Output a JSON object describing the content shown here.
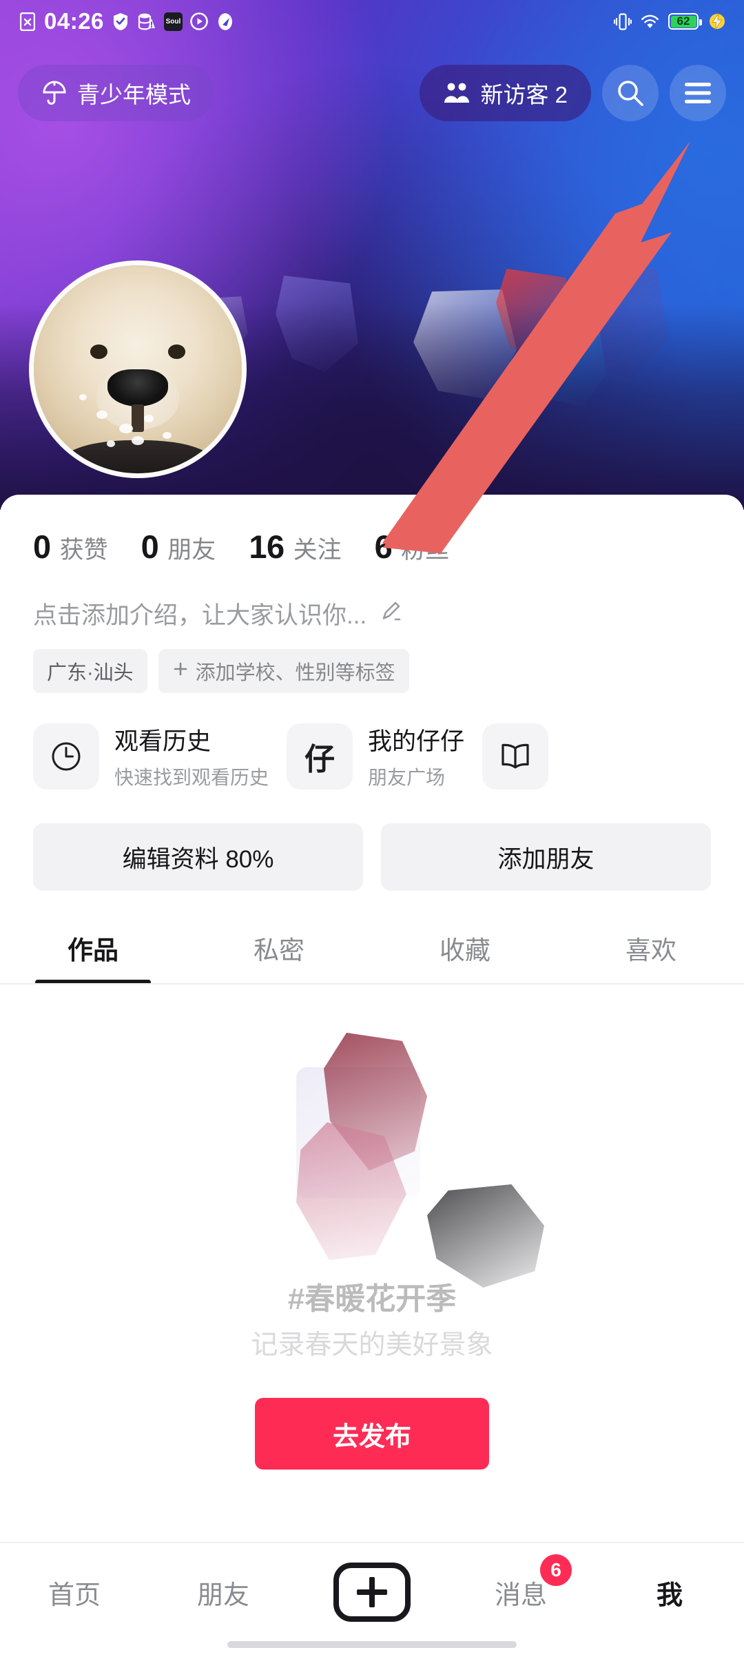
{
  "status_bar": {
    "time": "04:26",
    "battery_level": "62",
    "left_icons": [
      "sim-error-icon",
      "shield-check-icon",
      "data-saver-icon",
      "soul-app-icon",
      "play-circle-icon",
      "compass-icon"
    ],
    "right_icons": [
      "vibrate-icon",
      "wifi-icon",
      "battery-icon",
      "charging-bolt-icon"
    ]
  },
  "top_bar": {
    "teen_mode_label": "青少年模式",
    "teen_mode_icon": "umbrella-icon",
    "visitor_label": "新访客 2",
    "visitor_icon": "visitors-icon",
    "search_icon": "search-icon",
    "menu_icon": "hamburger-menu-icon"
  },
  "annotation": {
    "type": "arrow",
    "color": "#e8635f",
    "points_to": "hamburger-menu-icon"
  },
  "profile": {
    "avatar_alt": "golden-retriever-puppy-avatar",
    "stats": [
      {
        "value": "0",
        "label": "获赞"
      },
      {
        "value": "0",
        "label": "朋友"
      },
      {
        "value": "16",
        "label": "关注"
      },
      {
        "value": "6",
        "label": "粉丝"
      }
    ],
    "bio_placeholder": "点击添加介绍，让大家认识你...",
    "bio_edit_icon": "pencil-icon",
    "tags": [
      {
        "label": "广东·汕头",
        "icon": null
      },
      {
        "label": "添加学校、性别等标签",
        "icon": "plus-icon"
      }
    ]
  },
  "quick_cards": [
    {
      "icon": "clock-icon",
      "title": "观看历史",
      "subtitle": "快速找到观看历史"
    },
    {
      "icon": "zai-character-icon",
      "icon_text": "仔",
      "title": "我的仔仔",
      "subtitle": "朋友广场"
    },
    {
      "icon": "book-icon",
      "title": "",
      "subtitle": ""
    }
  ],
  "actions": [
    {
      "label": "编辑资料 80%"
    },
    {
      "label": "添加朋友"
    }
  ],
  "content_tabs": [
    {
      "label": "作品",
      "active": true
    },
    {
      "label": "私密",
      "active": false
    },
    {
      "label": "收藏",
      "active": false
    },
    {
      "label": "喜欢",
      "active": false
    }
  ],
  "empty_state": {
    "headline": "#春暖花开季",
    "subline": "记录春天的美好景象",
    "publish_label": "去发布",
    "publish_color": "#fe2c55"
  },
  "bottom_nav": {
    "items": [
      {
        "label": "首页",
        "active": false
      },
      {
        "label": "朋友",
        "active": false
      },
      {
        "label": "",
        "icon": "plus-create-icon",
        "active": false
      },
      {
        "label": "消息",
        "active": false,
        "badge": "6"
      },
      {
        "label": "我",
        "active": true
      }
    ]
  }
}
